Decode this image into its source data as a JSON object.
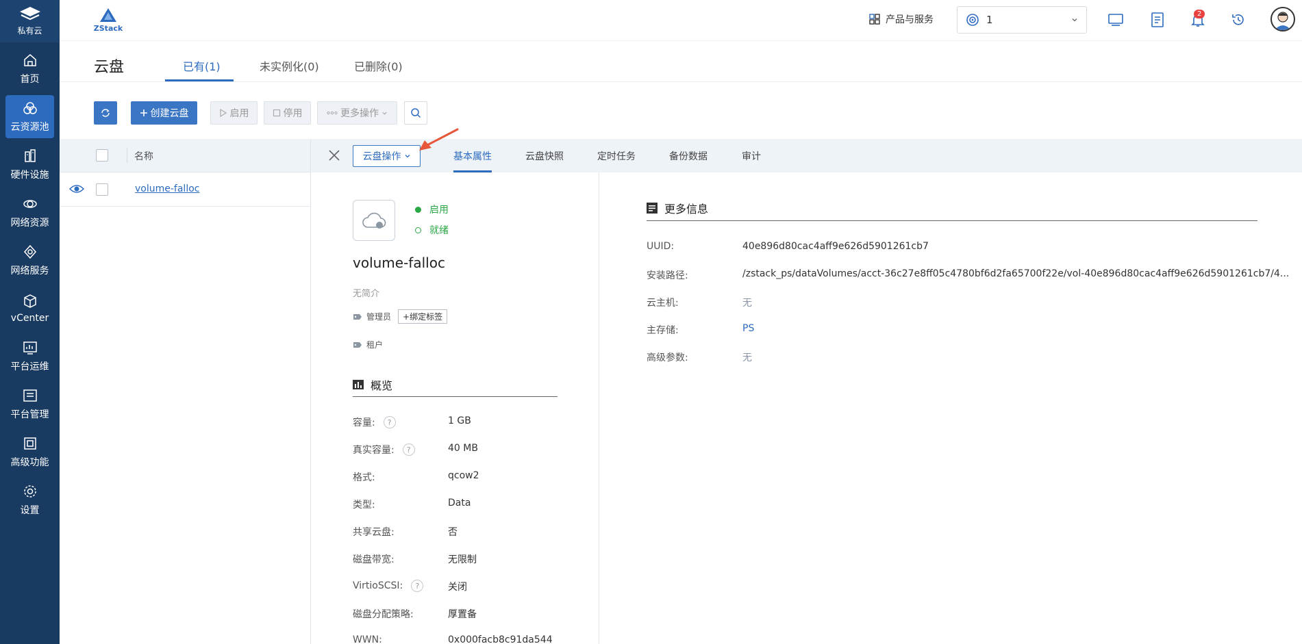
{
  "sidebar": {
    "brand_label": "私有云",
    "items": [
      {
        "label": "首页",
        "icon": "home-icon"
      },
      {
        "label": "云资源池",
        "icon": "resource-pool-icon",
        "active": true
      },
      {
        "label": "硬件设施",
        "icon": "hardware-icon"
      },
      {
        "label": "网络资源",
        "icon": "network-resource-icon"
      },
      {
        "label": "网络服务",
        "icon": "network-service-icon"
      },
      {
        "label": "vCenter",
        "icon": "vcenter-icon"
      },
      {
        "label": "平台运维",
        "icon": "ops-icon"
      },
      {
        "label": "平台管理",
        "icon": "platform-management-icon"
      },
      {
        "label": "高级功能",
        "icon": "advanced-icon"
      },
      {
        "label": "设置",
        "icon": "settings-icon"
      }
    ]
  },
  "header": {
    "logo_text": "ZStack",
    "products_label": "产品与服务",
    "project_value": "1",
    "notification_count": "2"
  },
  "page": {
    "title": "云盘",
    "tabs": [
      "已有(1)",
      "未实例化(0)",
      "已删除(0)"
    ]
  },
  "toolbar": {
    "create_label": "创建云盘",
    "enable_label": "启用",
    "disable_label": "停用",
    "more_label": "更多操作"
  },
  "list": {
    "column_name": "名称",
    "rows": [
      {
        "name": "volume-falloc"
      }
    ]
  },
  "detail": {
    "op_button": "云盘操作",
    "tabs": [
      "基本属性",
      "云盘快照",
      "定时任务",
      "备份数据",
      "审计"
    ],
    "state": "启用",
    "status": "就绪",
    "name": "volume-falloc",
    "description": "无简介",
    "admin_tag_label": "管理员",
    "bind_tag_label": "绑定标签",
    "tenant_tag_label": "租户",
    "overview_title": "概览",
    "properties": [
      {
        "label": "容量:",
        "value": "1 GB",
        "help": true
      },
      {
        "label": "真实容量:",
        "value": "40 MB",
        "help": true
      },
      {
        "label": "格式:",
        "value": "qcow2"
      },
      {
        "label": "类型:",
        "value": "Data"
      },
      {
        "label": "共享云盘:",
        "value": "否"
      },
      {
        "label": "磁盘带宽:",
        "value": "无限制"
      },
      {
        "label": "VirtioSCSI:",
        "value": "关闭",
        "help": true
      },
      {
        "label": "磁盘分配策略:",
        "value": "厚置备"
      },
      {
        "label": "WWN:",
        "value": "0x000facb8c91da544"
      }
    ],
    "more_info_title": "更多信息",
    "more_info": [
      {
        "label": "UUID:",
        "value": "40e896d80cac4aff9e626d5901261cb7"
      },
      {
        "label": "安装路径:",
        "value": "/zstack_ps/dataVolumes/acct-36c27e8ff05c4780bf6d2fa65700f22e/vol-40e896d80cac4aff9e626d5901261cb7/4..."
      },
      {
        "label": "云主机:",
        "value": "无"
      },
      {
        "label": "主存储:",
        "value": "PS"
      },
      {
        "label": "高级参数:",
        "value": "无"
      }
    ]
  },
  "colors": {
    "sidebar_bg": "#193a61",
    "accent": "#2d6bbf",
    "status_green": "#2aa745",
    "arrow": "#e8563a"
  }
}
